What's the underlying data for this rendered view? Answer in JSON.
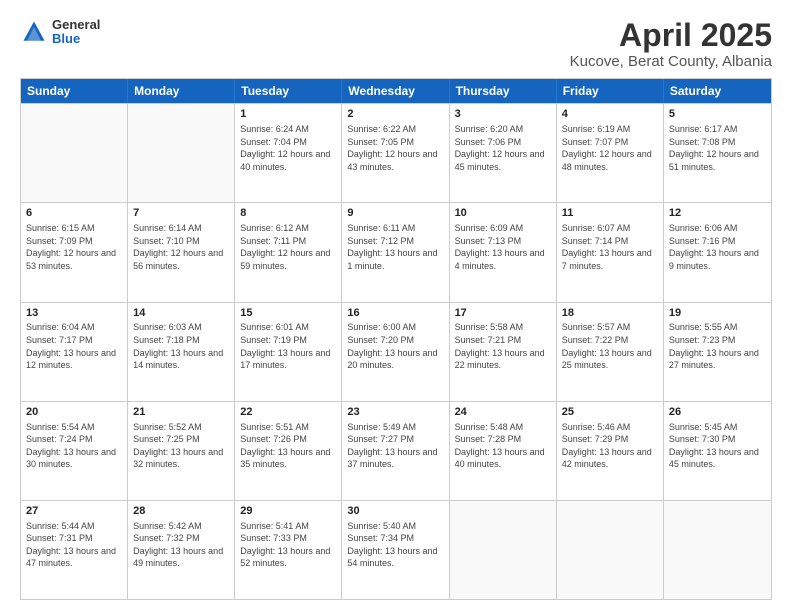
{
  "header": {
    "logo": {
      "general": "General",
      "blue": "Blue"
    },
    "title": "April 2025",
    "subtitle": "Kucove, Berat County, Albania"
  },
  "calendar": {
    "days": [
      "Sunday",
      "Monday",
      "Tuesday",
      "Wednesday",
      "Thursday",
      "Friday",
      "Saturday"
    ],
    "weeks": [
      [
        {
          "day": "",
          "info": ""
        },
        {
          "day": "",
          "info": ""
        },
        {
          "day": "1",
          "info": "Sunrise: 6:24 AM\nSunset: 7:04 PM\nDaylight: 12 hours and 40 minutes."
        },
        {
          "day": "2",
          "info": "Sunrise: 6:22 AM\nSunset: 7:05 PM\nDaylight: 12 hours and 43 minutes."
        },
        {
          "day": "3",
          "info": "Sunrise: 6:20 AM\nSunset: 7:06 PM\nDaylight: 12 hours and 45 minutes."
        },
        {
          "day": "4",
          "info": "Sunrise: 6:19 AM\nSunset: 7:07 PM\nDaylight: 12 hours and 48 minutes."
        },
        {
          "day": "5",
          "info": "Sunrise: 6:17 AM\nSunset: 7:08 PM\nDaylight: 12 hours and 51 minutes."
        }
      ],
      [
        {
          "day": "6",
          "info": "Sunrise: 6:15 AM\nSunset: 7:09 PM\nDaylight: 12 hours and 53 minutes."
        },
        {
          "day": "7",
          "info": "Sunrise: 6:14 AM\nSunset: 7:10 PM\nDaylight: 12 hours and 56 minutes."
        },
        {
          "day": "8",
          "info": "Sunrise: 6:12 AM\nSunset: 7:11 PM\nDaylight: 12 hours and 59 minutes."
        },
        {
          "day": "9",
          "info": "Sunrise: 6:11 AM\nSunset: 7:12 PM\nDaylight: 13 hours and 1 minute."
        },
        {
          "day": "10",
          "info": "Sunrise: 6:09 AM\nSunset: 7:13 PM\nDaylight: 13 hours and 4 minutes."
        },
        {
          "day": "11",
          "info": "Sunrise: 6:07 AM\nSunset: 7:14 PM\nDaylight: 13 hours and 7 minutes."
        },
        {
          "day": "12",
          "info": "Sunrise: 6:06 AM\nSunset: 7:16 PM\nDaylight: 13 hours and 9 minutes."
        }
      ],
      [
        {
          "day": "13",
          "info": "Sunrise: 6:04 AM\nSunset: 7:17 PM\nDaylight: 13 hours and 12 minutes."
        },
        {
          "day": "14",
          "info": "Sunrise: 6:03 AM\nSunset: 7:18 PM\nDaylight: 13 hours and 14 minutes."
        },
        {
          "day": "15",
          "info": "Sunrise: 6:01 AM\nSunset: 7:19 PM\nDaylight: 13 hours and 17 minutes."
        },
        {
          "day": "16",
          "info": "Sunrise: 6:00 AM\nSunset: 7:20 PM\nDaylight: 13 hours and 20 minutes."
        },
        {
          "day": "17",
          "info": "Sunrise: 5:58 AM\nSunset: 7:21 PM\nDaylight: 13 hours and 22 minutes."
        },
        {
          "day": "18",
          "info": "Sunrise: 5:57 AM\nSunset: 7:22 PM\nDaylight: 13 hours and 25 minutes."
        },
        {
          "day": "19",
          "info": "Sunrise: 5:55 AM\nSunset: 7:23 PM\nDaylight: 13 hours and 27 minutes."
        }
      ],
      [
        {
          "day": "20",
          "info": "Sunrise: 5:54 AM\nSunset: 7:24 PM\nDaylight: 13 hours and 30 minutes."
        },
        {
          "day": "21",
          "info": "Sunrise: 5:52 AM\nSunset: 7:25 PM\nDaylight: 13 hours and 32 minutes."
        },
        {
          "day": "22",
          "info": "Sunrise: 5:51 AM\nSunset: 7:26 PM\nDaylight: 13 hours and 35 minutes."
        },
        {
          "day": "23",
          "info": "Sunrise: 5:49 AM\nSunset: 7:27 PM\nDaylight: 13 hours and 37 minutes."
        },
        {
          "day": "24",
          "info": "Sunrise: 5:48 AM\nSunset: 7:28 PM\nDaylight: 13 hours and 40 minutes."
        },
        {
          "day": "25",
          "info": "Sunrise: 5:46 AM\nSunset: 7:29 PM\nDaylight: 13 hours and 42 minutes."
        },
        {
          "day": "26",
          "info": "Sunrise: 5:45 AM\nSunset: 7:30 PM\nDaylight: 13 hours and 45 minutes."
        }
      ],
      [
        {
          "day": "27",
          "info": "Sunrise: 5:44 AM\nSunset: 7:31 PM\nDaylight: 13 hours and 47 minutes."
        },
        {
          "day": "28",
          "info": "Sunrise: 5:42 AM\nSunset: 7:32 PM\nDaylight: 13 hours and 49 minutes."
        },
        {
          "day": "29",
          "info": "Sunrise: 5:41 AM\nSunset: 7:33 PM\nDaylight: 13 hours and 52 minutes."
        },
        {
          "day": "30",
          "info": "Sunrise: 5:40 AM\nSunset: 7:34 PM\nDaylight: 13 hours and 54 minutes."
        },
        {
          "day": "",
          "info": ""
        },
        {
          "day": "",
          "info": ""
        },
        {
          "day": "",
          "info": ""
        }
      ]
    ]
  }
}
